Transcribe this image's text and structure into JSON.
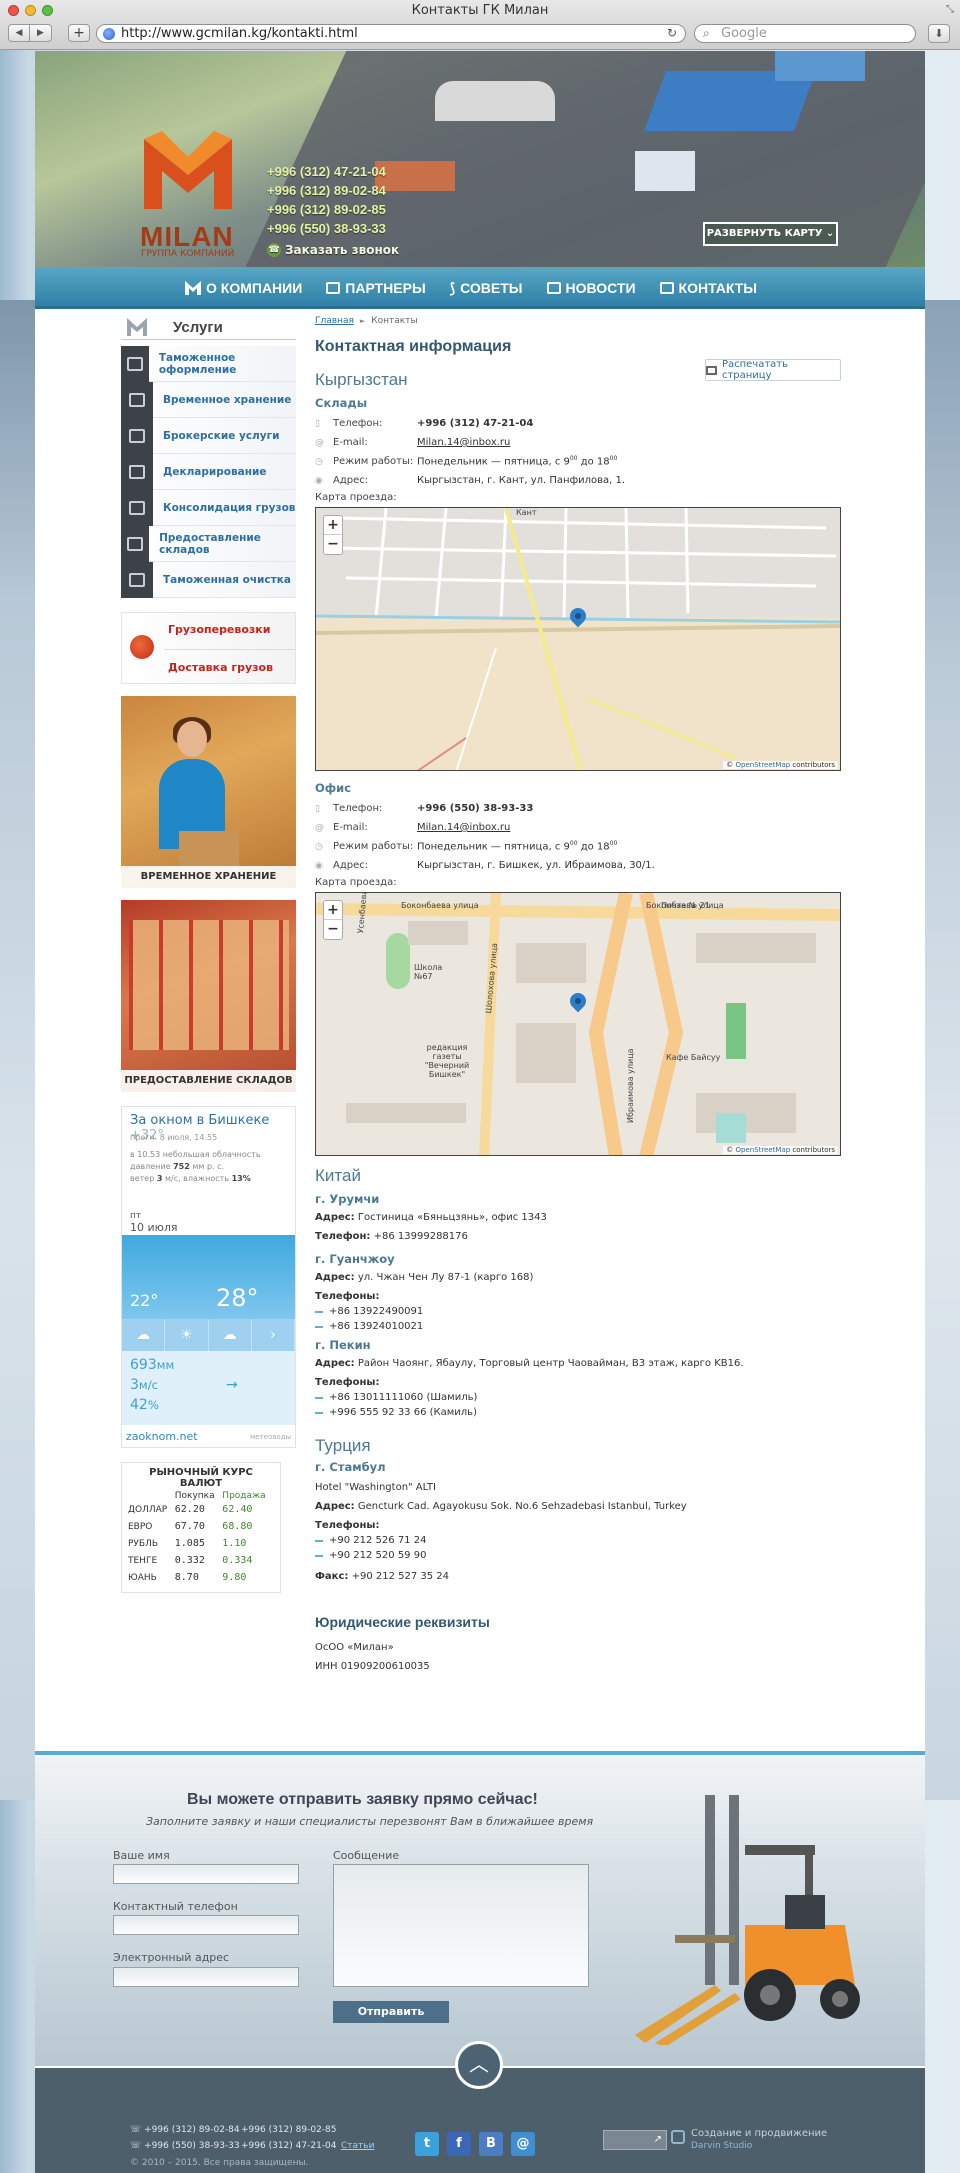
{
  "browser": {
    "window_title": "Контакты ГК Милан",
    "url": "http://www.gcmilan.kg/kontakti.html",
    "search_placeholder": "Google"
  },
  "header": {
    "logo_name": "MILAN",
    "logo_sub": "ГРУППА КОМПАНИЙ",
    "phones": [
      "+996 (312) 47-21-04",
      "+996 (312) 89-02-84",
      "+996 (312) 89-02-85",
      "+996 (550) 38-93-33"
    ],
    "callback": "Заказать звонок",
    "map_button": "РАЗВЕРНУТЬ КАРТУ"
  },
  "nav": [
    {
      "label": "О КОМПАНИИ",
      "icon": "m-logo-icon"
    },
    {
      "label": "ПАРТНЕРЫ",
      "icon": "book-icon"
    },
    {
      "label": "СОВЕТЫ",
      "icon": "paperclip-icon"
    },
    {
      "label": "НОВОСТИ",
      "icon": "newspaper-icon"
    },
    {
      "label": "КОНТАКТЫ",
      "icon": "envelope-icon"
    }
  ],
  "sidebar": {
    "title": "Услуги",
    "services": [
      "Таможенное оформление",
      "Временное хранение",
      "Брокерские услуги",
      "Декларирование",
      "Консолидация грузов",
      "Предоставление складов",
      "Таможенная очистка"
    ],
    "cargo": [
      "Грузоперевозки",
      "Доставка грузов"
    ],
    "promo1": "ВРЕМЕННОЕ ХРАНЕНИЕ",
    "promo2": "ПРЕДОСТАВЛЕНИЕ СКЛАДОВ",
    "weather": {
      "title": "За окном в Бишкеке",
      "temp_now": "+32°",
      "updated": "прогн. 8 июля, 14.55",
      "desc1": "в 10.53 небольшая облачность",
      "desc2_pre": "давление ",
      "pressure": "752",
      "desc2_post": " мм р. с.",
      "desc3_pre": "ветер ",
      "wind": "3",
      "desc3_mid": " м/с,  влажность ",
      "humidity": "13%",
      "day": "пт",
      "date": "10 июля",
      "t_low": "22°",
      "t_high": "28°",
      "stat1": "693",
      "stat1_unit": "мм",
      "stat2": "3",
      "stat2_unit": "м/с",
      "stat3": "42",
      "stat3_unit": "%",
      "site": "zaoknom.net",
      "meteo": "метеоводы"
    },
    "rates": {
      "title": "РЫНОЧНЫЙ КУРС ВАЛЮТ",
      "buy_label": "Покупка",
      "sell_label": "Продажа",
      "rows": [
        {
          "cur": "ДОЛЛАР",
          "buy": "62.20",
          "sell": "62.40"
        },
        {
          "cur": "ЕВРО",
          "buy": "67.70",
          "sell": "68.80"
        },
        {
          "cur": "РУБЛЬ",
          "buy": "1.085",
          "sell": "1.10"
        },
        {
          "cur": "ТЕНГЕ",
          "buy": "0.332",
          "sell": "0.334"
        },
        {
          "cur": "ЮАНЬ",
          "buy": "8.70",
          "sell": "9.80"
        }
      ]
    }
  },
  "main": {
    "breadcrumb_home": "Главная",
    "breadcrumb_sep": "►",
    "breadcrumb_current": "Контакты",
    "title": "Контактная информация",
    "print": "Распечатать страницу",
    "kg_title": "Кыргызстан",
    "labels": {
      "phone": "Телефон:",
      "email": "E-mail:",
      "hours": "Режим работы:",
      "address": "Адрес:",
      "map": "Карта проезда:"
    },
    "warehouses": {
      "title": "Склады",
      "phone": "+996 (312) 47-21-04",
      "email": "Milan.14@inbox.ru",
      "hours_pre": "Понедельник — пятница, с 9",
      "hours_sup1": "00",
      "hours_mid": " до 18",
      "hours_sup2": "00",
      "address": "Кыргызстан, г. Кант, ул. Панфилова, 1."
    },
    "office": {
      "title": "Офис",
      "phone": "+996 (550) 38-93-33",
      "email": "Milan.14@inbox.ru",
      "hours_pre": "Понедельник — пятница, с 9",
      "hours_sup1": "00",
      "hours_mid": " до 18",
      "hours_sup2": "00",
      "address": "Кыргызстан, г. Бишкек, ул. Ибраимова, 30/1."
    },
    "map_attr": "© OpenStreetMap contributors",
    "map_attr_link": "OpenStreetMap",
    "map1_labels": [
      "Кант"
    ],
    "map2_labels": [
      "Боконбаева улица",
      "Школа №67",
      "Усенбаева",
      "Шолохова улица",
      "редакция газеты \"Вечерний Бишкек\"",
      "Ибраимова улица",
      "Кафе Байсуу",
      "Почта № 21"
    ],
    "china": {
      "title": "Китай",
      "urumqi_title": "г. Урумчи",
      "urumqi_addr_label": "Адрес:",
      "urumqi_addr": "Гостиница «Бяньцзянь», офис 1343",
      "urumqi_phone_label": "Телефон:",
      "urumqi_phone": "+86 13999288176",
      "guangzhou_title": "г. Гуанчжоу",
      "guangzhou_addr_label": "Адрес:",
      "guangzhou_addr": "ул. Чжан Чен Лу 87-1 (карго 168)",
      "guangzhou_phones_label": "Телефоны:",
      "guangzhou_phones": [
        "+86 13922490091",
        "+86 13924010021"
      ],
      "beijing_title": "г. Пекин",
      "beijing_addr_label": "Адрес:",
      "beijing_addr": "Район Чаоянг, Ябаулу, Торговый центр Чаовайман, B3 этаж, карго KB16.",
      "beijing_phones_label": "Телефоны:",
      "beijing_phones": [
        "+86 13011111060  (Шамиль)",
        "+996 555 92 33 66 (Камиль)"
      ]
    },
    "turkey": {
      "title": "Турция",
      "istanbul_title": "г. Стамбул",
      "hotel": "Hotel \"Washington\" ALTI",
      "addr_label": "Адрес:",
      "addr": "Gencturk Cad. Agayokusu Sok. No.6 Sehzadebasi Istanbul, Turkey",
      "phones_label": "Телефоны:",
      "phones": [
        "+90 212 526 71 24",
        "+90 212 520 59 90"
      ],
      "fax_label": "Факс:",
      "fax": "+90 212 527 35 24"
    },
    "legal": {
      "title": "Юридические реквизиты",
      "company": "ОсОО «Милан»",
      "inn": "ИНН 01909200610035"
    }
  },
  "form": {
    "title": "Вы можете отправить заявку прямо сейчас!",
    "subtitle": "Заполните заявку и наши специалисты перезвонят Вам в ближайшее время",
    "name_label": "Ваше имя",
    "phone_label": "Контактный телефон",
    "email_label": "Электронный адрес",
    "message_label": "Сообщение",
    "submit": "Отправить"
  },
  "footer": {
    "phones": [
      "+996 (312) 89-02-84",
      "+996 (312) 89-02-85",
      "+996 (550) 38-93-33",
      "+996 (312) 47-21-04"
    ],
    "stats_link": "Статьи",
    "copyright": "© 2010 – 2015. Все права защищены.",
    "social": [
      "t",
      "f",
      "B",
      "@"
    ],
    "counter": "↗",
    "dev1": "Создание и продвижение",
    "dev2": "Darvin Studio"
  },
  "colors": {
    "nav": "#2f7fa6",
    "link": "#2d6fa4",
    "heading": "#33586f",
    "accent_red": "#c9221c",
    "sell_green": "#3e8a2a"
  }
}
